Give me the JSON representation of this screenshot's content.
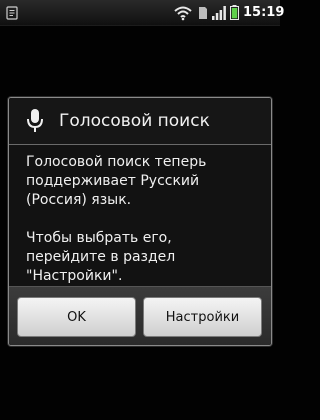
{
  "status_bar": {
    "time": "15:19",
    "icons": [
      "notification-icon",
      "wifi-icon",
      "sim-icon",
      "signal-icon",
      "battery-icon"
    ]
  },
  "dialog": {
    "title": "Голосовой поиск",
    "icon": "microphone-icon",
    "message_line_1": "Голосовой поиск теперь\nподдерживает Русский\n(Россия) язык.",
    "message_line_2": "Чтобы выбрать его,\nперейдите в раздел\n\"Настройки\".",
    "buttons": {
      "ok_label": "OK",
      "settings_label": "Настройки"
    }
  },
  "colors": {
    "background": "#020202",
    "dialog_border": "#8a8a8a",
    "button_face": "#e2e2e2",
    "text": "#f0f0f0"
  }
}
